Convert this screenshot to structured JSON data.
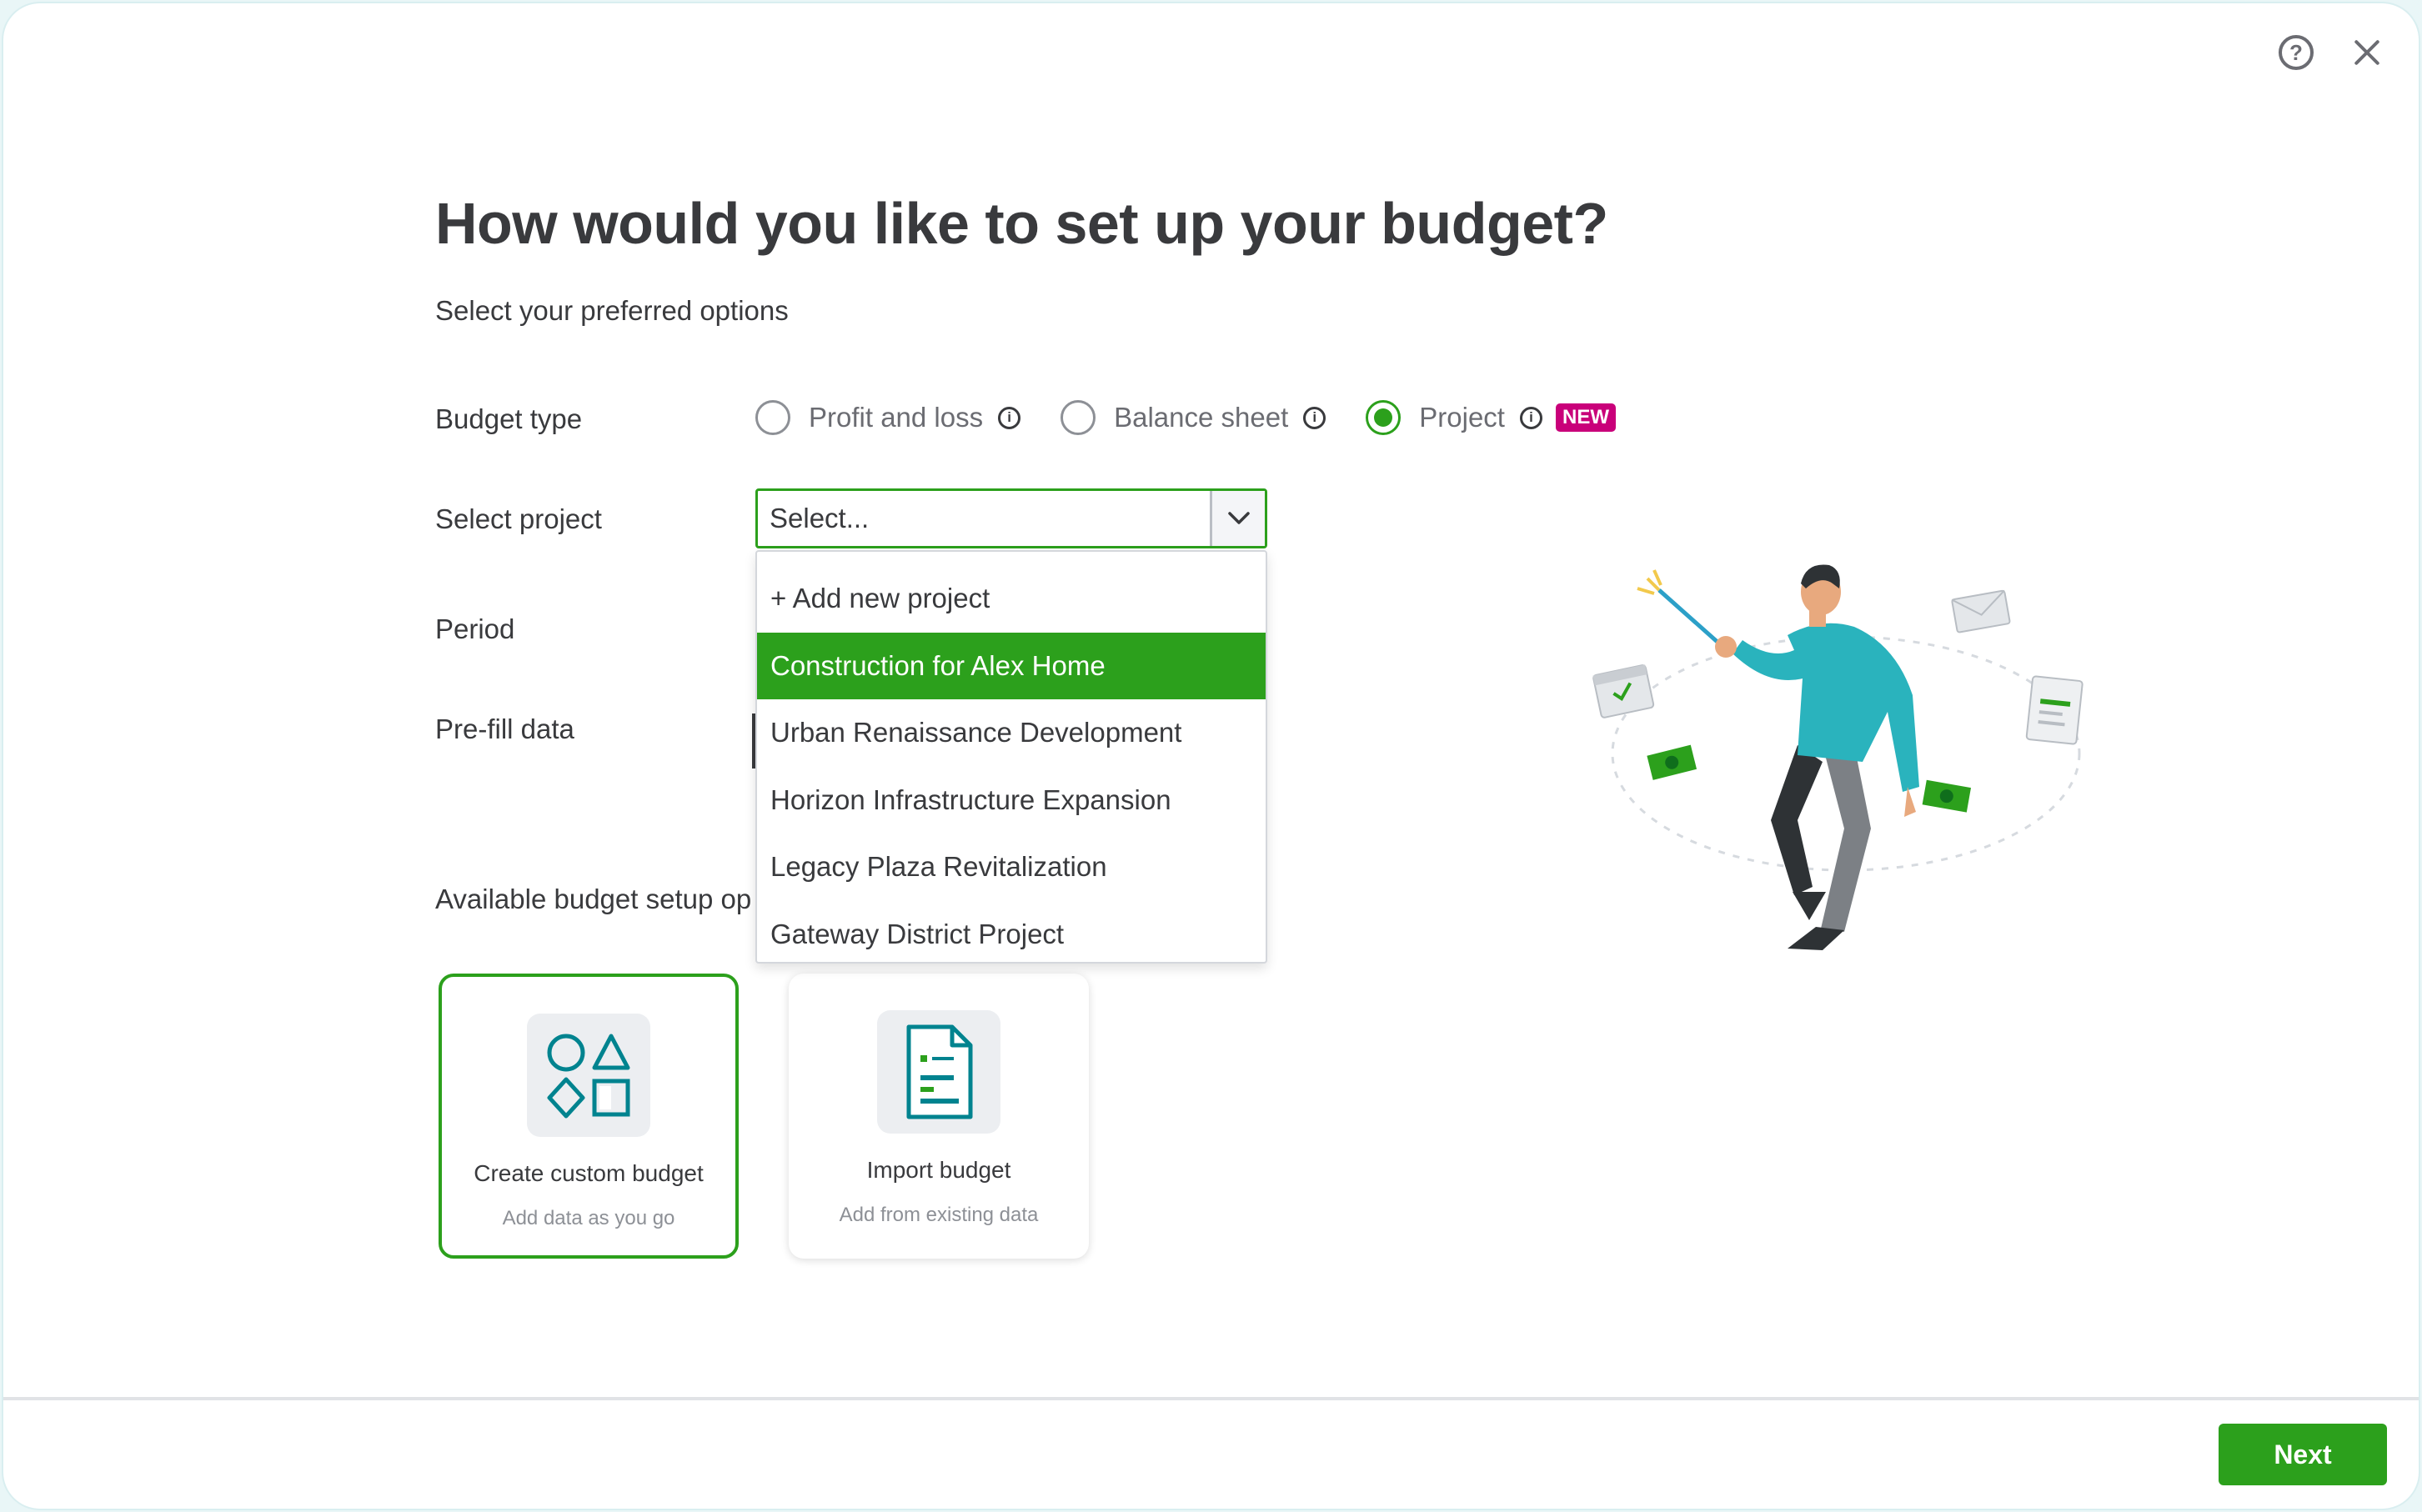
{
  "header": {
    "title": "How would you like to set up your budget?",
    "subtitle": "Select your preferred options",
    "help_icon": "?"
  },
  "form": {
    "budget_type_label": "Budget type",
    "budget_type_options": [
      {
        "label": "Profit and loss",
        "selected": false
      },
      {
        "label": "Balance sheet",
        "selected": false
      },
      {
        "label": "Project",
        "selected": true,
        "badge": "NEW"
      }
    ],
    "info_glyph": "i",
    "select_project_label": "Select project",
    "select_project_value": "Select...",
    "period_label": "Period",
    "prefill_label": "Pre-fill data",
    "available_label": "Available budget setup op"
  },
  "dropdown": {
    "items": [
      "+ Add new project",
      "Construction for Alex Home",
      "Urban Renaissance Development",
      "Horizon Infrastructure Expansion",
      "Legacy Plaza Revitalization",
      "Gateway District Project"
    ],
    "highlighted_index": 1
  },
  "cards": [
    {
      "title": "Create custom budget",
      "subtitle": "Add data as you go",
      "selected": true,
      "icon": "shapes-icon"
    },
    {
      "title": "Import budget",
      "subtitle": "Add from existing data",
      "selected": false,
      "icon": "document-icon"
    }
  ],
  "footer": {
    "next_label": "Next"
  },
  "colors": {
    "accent": "#2ca01c",
    "badge": "#c9007a",
    "text": "#393a3d",
    "muted": "#8d9096"
  }
}
